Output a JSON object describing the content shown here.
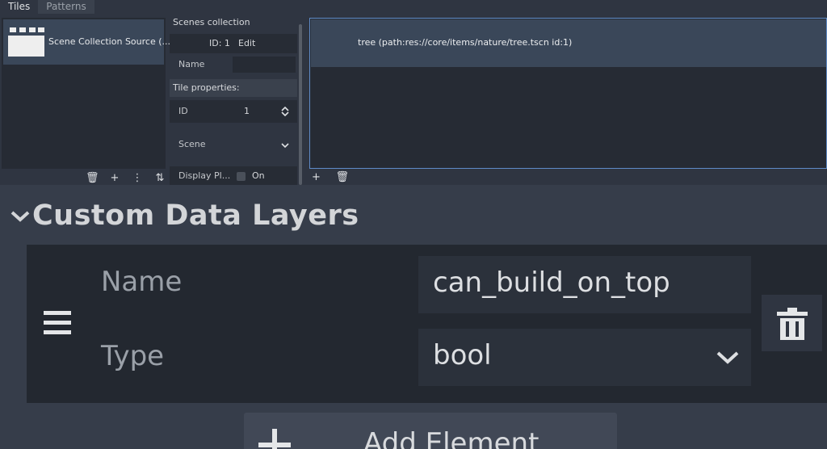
{
  "tabs": {
    "tiles": "Tiles",
    "patterns": "Patterns"
  },
  "sources": {
    "item_label": "Scene Collection Source (...",
    "toolbar": {
      "delete": "🗑",
      "add": "+",
      "menu": "⋮",
      "sort": "⇅"
    }
  },
  "properties": {
    "collection_header": "Scenes collection properties:",
    "id_text": "ID: 1",
    "edit_label": "Edit",
    "name_label": "Name",
    "name_value": "",
    "tile_header": "Tile properties:",
    "id_label": "ID",
    "id_value": "1",
    "scene_label": "Scene",
    "display_label": "Display Pl...",
    "display_value": "On"
  },
  "tile_list": {
    "item": "tree (path:res://core/items/nature/tree.tscn id:1)",
    "toolbar": {
      "add": "+",
      "delete": "🗑"
    }
  },
  "inspector": {
    "section_title": "Custom Data Layers",
    "name_label": "Name",
    "name_value": "can_build_on_top",
    "type_label": "Type",
    "type_value": "bool",
    "add_label": "Add Element"
  },
  "icons": {
    "section": "chevron-down-icon",
    "drag": "drag-handle-icon",
    "delete": "trash-icon",
    "dropdown": "chevron-down-icon",
    "add": "plus-icon",
    "spinner": "spin-arrows-icon"
  },
  "colors": {
    "selection": "#3a4759",
    "focus_border": "#5f8bc7",
    "panel_bg": "#232830"
  }
}
